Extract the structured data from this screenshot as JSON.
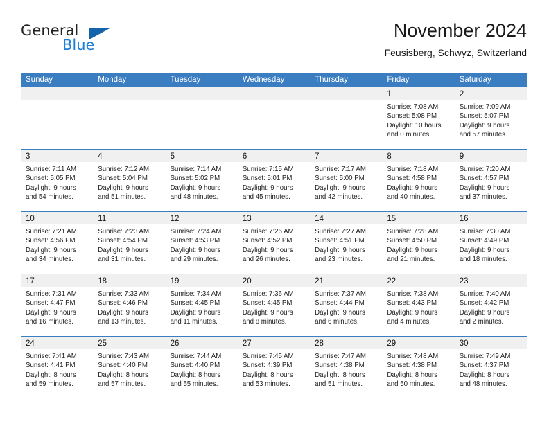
{
  "brand": {
    "name_part1": "General",
    "name_part2": "Blue",
    "triangle_color": "#1464ac",
    "blue_color": "#1c7fd6"
  },
  "header": {
    "title": "November 2024",
    "subtitle": "Feusisberg, Schwyz, Switzerland"
  },
  "theme": {
    "header_blue": "#3a7dc1",
    "daynum_band": "#f0f0f0"
  },
  "weekdays": [
    "Sunday",
    "Monday",
    "Tuesday",
    "Wednesday",
    "Thursday",
    "Friday",
    "Saturday"
  ],
  "weeks": [
    [
      {
        "day": "",
        "lines": []
      },
      {
        "day": "",
        "lines": []
      },
      {
        "day": "",
        "lines": []
      },
      {
        "day": "",
        "lines": []
      },
      {
        "day": "",
        "lines": []
      },
      {
        "day": "1",
        "lines": [
          "Sunrise: 7:08 AM",
          "Sunset: 5:08 PM",
          "Daylight: 10 hours",
          "and 0 minutes."
        ]
      },
      {
        "day": "2",
        "lines": [
          "Sunrise: 7:09 AM",
          "Sunset: 5:07 PM",
          "Daylight: 9 hours",
          "and 57 minutes."
        ]
      }
    ],
    [
      {
        "day": "3",
        "lines": [
          "Sunrise: 7:11 AM",
          "Sunset: 5:05 PM",
          "Daylight: 9 hours",
          "and 54 minutes."
        ]
      },
      {
        "day": "4",
        "lines": [
          "Sunrise: 7:12 AM",
          "Sunset: 5:04 PM",
          "Daylight: 9 hours",
          "and 51 minutes."
        ]
      },
      {
        "day": "5",
        "lines": [
          "Sunrise: 7:14 AM",
          "Sunset: 5:02 PM",
          "Daylight: 9 hours",
          "and 48 minutes."
        ]
      },
      {
        "day": "6",
        "lines": [
          "Sunrise: 7:15 AM",
          "Sunset: 5:01 PM",
          "Daylight: 9 hours",
          "and 45 minutes."
        ]
      },
      {
        "day": "7",
        "lines": [
          "Sunrise: 7:17 AM",
          "Sunset: 5:00 PM",
          "Daylight: 9 hours",
          "and 42 minutes."
        ]
      },
      {
        "day": "8",
        "lines": [
          "Sunrise: 7:18 AM",
          "Sunset: 4:58 PM",
          "Daylight: 9 hours",
          "and 40 minutes."
        ]
      },
      {
        "day": "9",
        "lines": [
          "Sunrise: 7:20 AM",
          "Sunset: 4:57 PM",
          "Daylight: 9 hours",
          "and 37 minutes."
        ]
      }
    ],
    [
      {
        "day": "10",
        "lines": [
          "Sunrise: 7:21 AM",
          "Sunset: 4:56 PM",
          "Daylight: 9 hours",
          "and 34 minutes."
        ]
      },
      {
        "day": "11",
        "lines": [
          "Sunrise: 7:23 AM",
          "Sunset: 4:54 PM",
          "Daylight: 9 hours",
          "and 31 minutes."
        ]
      },
      {
        "day": "12",
        "lines": [
          "Sunrise: 7:24 AM",
          "Sunset: 4:53 PM",
          "Daylight: 9 hours",
          "and 29 minutes."
        ]
      },
      {
        "day": "13",
        "lines": [
          "Sunrise: 7:26 AM",
          "Sunset: 4:52 PM",
          "Daylight: 9 hours",
          "and 26 minutes."
        ]
      },
      {
        "day": "14",
        "lines": [
          "Sunrise: 7:27 AM",
          "Sunset: 4:51 PM",
          "Daylight: 9 hours",
          "and 23 minutes."
        ]
      },
      {
        "day": "15",
        "lines": [
          "Sunrise: 7:28 AM",
          "Sunset: 4:50 PM",
          "Daylight: 9 hours",
          "and 21 minutes."
        ]
      },
      {
        "day": "16",
        "lines": [
          "Sunrise: 7:30 AM",
          "Sunset: 4:49 PM",
          "Daylight: 9 hours",
          "and 18 minutes."
        ]
      }
    ],
    [
      {
        "day": "17",
        "lines": [
          "Sunrise: 7:31 AM",
          "Sunset: 4:47 PM",
          "Daylight: 9 hours",
          "and 16 minutes."
        ]
      },
      {
        "day": "18",
        "lines": [
          "Sunrise: 7:33 AM",
          "Sunset: 4:46 PM",
          "Daylight: 9 hours",
          "and 13 minutes."
        ]
      },
      {
        "day": "19",
        "lines": [
          "Sunrise: 7:34 AM",
          "Sunset: 4:45 PM",
          "Daylight: 9 hours",
          "and 11 minutes."
        ]
      },
      {
        "day": "20",
        "lines": [
          "Sunrise: 7:36 AM",
          "Sunset: 4:45 PM",
          "Daylight: 9 hours",
          "and 8 minutes."
        ]
      },
      {
        "day": "21",
        "lines": [
          "Sunrise: 7:37 AM",
          "Sunset: 4:44 PM",
          "Daylight: 9 hours",
          "and 6 minutes."
        ]
      },
      {
        "day": "22",
        "lines": [
          "Sunrise: 7:38 AM",
          "Sunset: 4:43 PM",
          "Daylight: 9 hours",
          "and 4 minutes."
        ]
      },
      {
        "day": "23",
        "lines": [
          "Sunrise: 7:40 AM",
          "Sunset: 4:42 PM",
          "Daylight: 9 hours",
          "and 2 minutes."
        ]
      }
    ],
    [
      {
        "day": "24",
        "lines": [
          "Sunrise: 7:41 AM",
          "Sunset: 4:41 PM",
          "Daylight: 8 hours",
          "and 59 minutes."
        ]
      },
      {
        "day": "25",
        "lines": [
          "Sunrise: 7:43 AM",
          "Sunset: 4:40 PM",
          "Daylight: 8 hours",
          "and 57 minutes."
        ]
      },
      {
        "day": "26",
        "lines": [
          "Sunrise: 7:44 AM",
          "Sunset: 4:40 PM",
          "Daylight: 8 hours",
          "and 55 minutes."
        ]
      },
      {
        "day": "27",
        "lines": [
          "Sunrise: 7:45 AM",
          "Sunset: 4:39 PM",
          "Daylight: 8 hours",
          "and 53 minutes."
        ]
      },
      {
        "day": "28",
        "lines": [
          "Sunrise: 7:47 AM",
          "Sunset: 4:38 PM",
          "Daylight: 8 hours",
          "and 51 minutes."
        ]
      },
      {
        "day": "29",
        "lines": [
          "Sunrise: 7:48 AM",
          "Sunset: 4:38 PM",
          "Daylight: 8 hours",
          "and 50 minutes."
        ]
      },
      {
        "day": "30",
        "lines": [
          "Sunrise: 7:49 AM",
          "Sunset: 4:37 PM",
          "Daylight: 8 hours",
          "and 48 minutes."
        ]
      }
    ]
  ]
}
